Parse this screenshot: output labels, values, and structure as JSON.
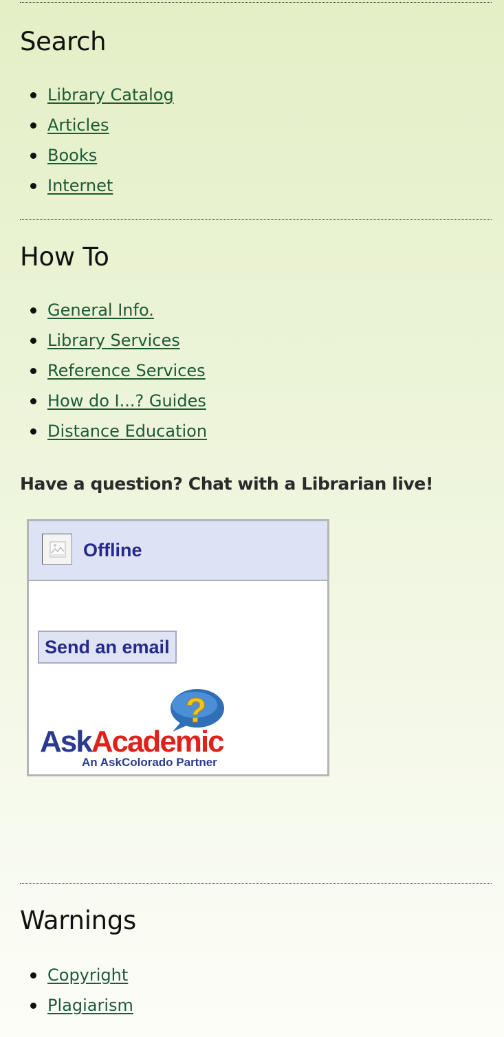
{
  "search": {
    "title": "Search",
    "links": [
      {
        "label": "Library Catalog"
      },
      {
        "label": "Articles"
      },
      {
        "label": "Books"
      },
      {
        "label": "Internet"
      }
    ]
  },
  "howto": {
    "title": "How To",
    "links": [
      {
        "label": "General Info."
      },
      {
        "label": "Library Services"
      },
      {
        "label": "Reference Services"
      },
      {
        "label": "How do I...? Guides"
      },
      {
        "label": "Distance Education"
      }
    ]
  },
  "chat": {
    "heading": "Have a question? Chat with a Librarian live!",
    "status": "Offline",
    "status_icon": "broken-image-icon",
    "email_button_label": "Send an email",
    "logo": {
      "word_ask": "Ask",
      "word_academic": "Academic",
      "tagline": "An AskColorado Partner",
      "question_mark": "?",
      "colors": {
        "ask": "#2a3b8f",
        "academic": "#e0201b",
        "bubble": "#2f6fb7",
        "question_mark": "#f5c419"
      }
    }
  },
  "warnings": {
    "title": "Warnings",
    "links": [
      {
        "label": "Copyright"
      },
      {
        "label": "Plagiarism"
      }
    ]
  },
  "colors": {
    "link": "#1d5a36",
    "background_top": "#e4efc6",
    "background_bottom": "#fdfdf8",
    "widget_header": "#dde3f4",
    "widget_text": "#25298a"
  }
}
